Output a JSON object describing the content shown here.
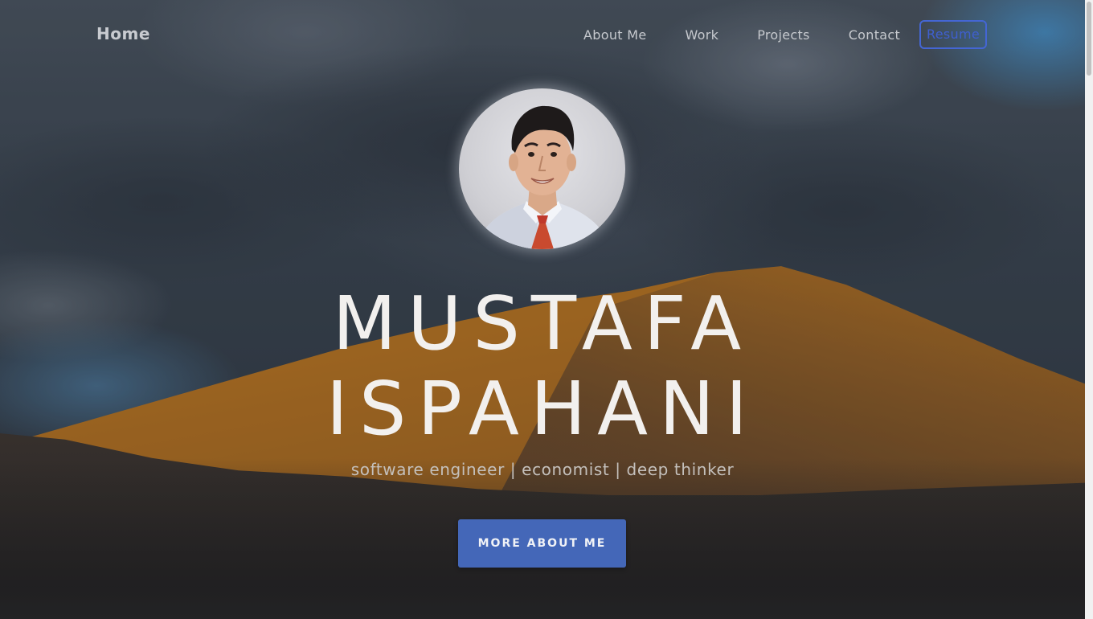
{
  "nav": {
    "home_label": "Home",
    "links": [
      {
        "label": "About Me"
      },
      {
        "label": "Work"
      },
      {
        "label": "Projects"
      },
      {
        "label": "Contact"
      }
    ],
    "resume_label": "Resume"
  },
  "hero": {
    "avatar_icon": "profile-photo",
    "name_line1": "MUSTAFA",
    "name_line2": "ISPAHANI",
    "tagline": "software engineer | economist | deep thinker",
    "cta_label": "MORE ABOUT ME"
  },
  "colors": {
    "accent": "#4467b8",
    "resume_border": "#4466d4",
    "name_text": "#f2f0ee"
  }
}
